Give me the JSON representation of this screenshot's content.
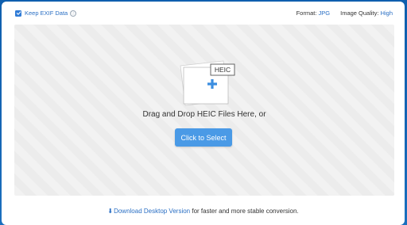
{
  "options": {
    "keep_exif_label": "Keep EXIF Data",
    "keep_exif_checked": true,
    "info_icon": "ⓘ",
    "format_label": "Format:",
    "format_value": "JPG",
    "quality_label": "Image Quality:",
    "quality_value": "High"
  },
  "dropzone": {
    "file_badge": "HEIC",
    "instruction": "Drag and Drop HEIC Files Here, or",
    "select_button": "Click to Select"
  },
  "footer": {
    "download_icon": "⬇",
    "download_link": "Download Desktop Version",
    "suffix": " for faster and more stable conversion."
  },
  "colors": {
    "accent": "#2a6fc4",
    "button": "#4a9ae6",
    "background": "#1565b4"
  }
}
